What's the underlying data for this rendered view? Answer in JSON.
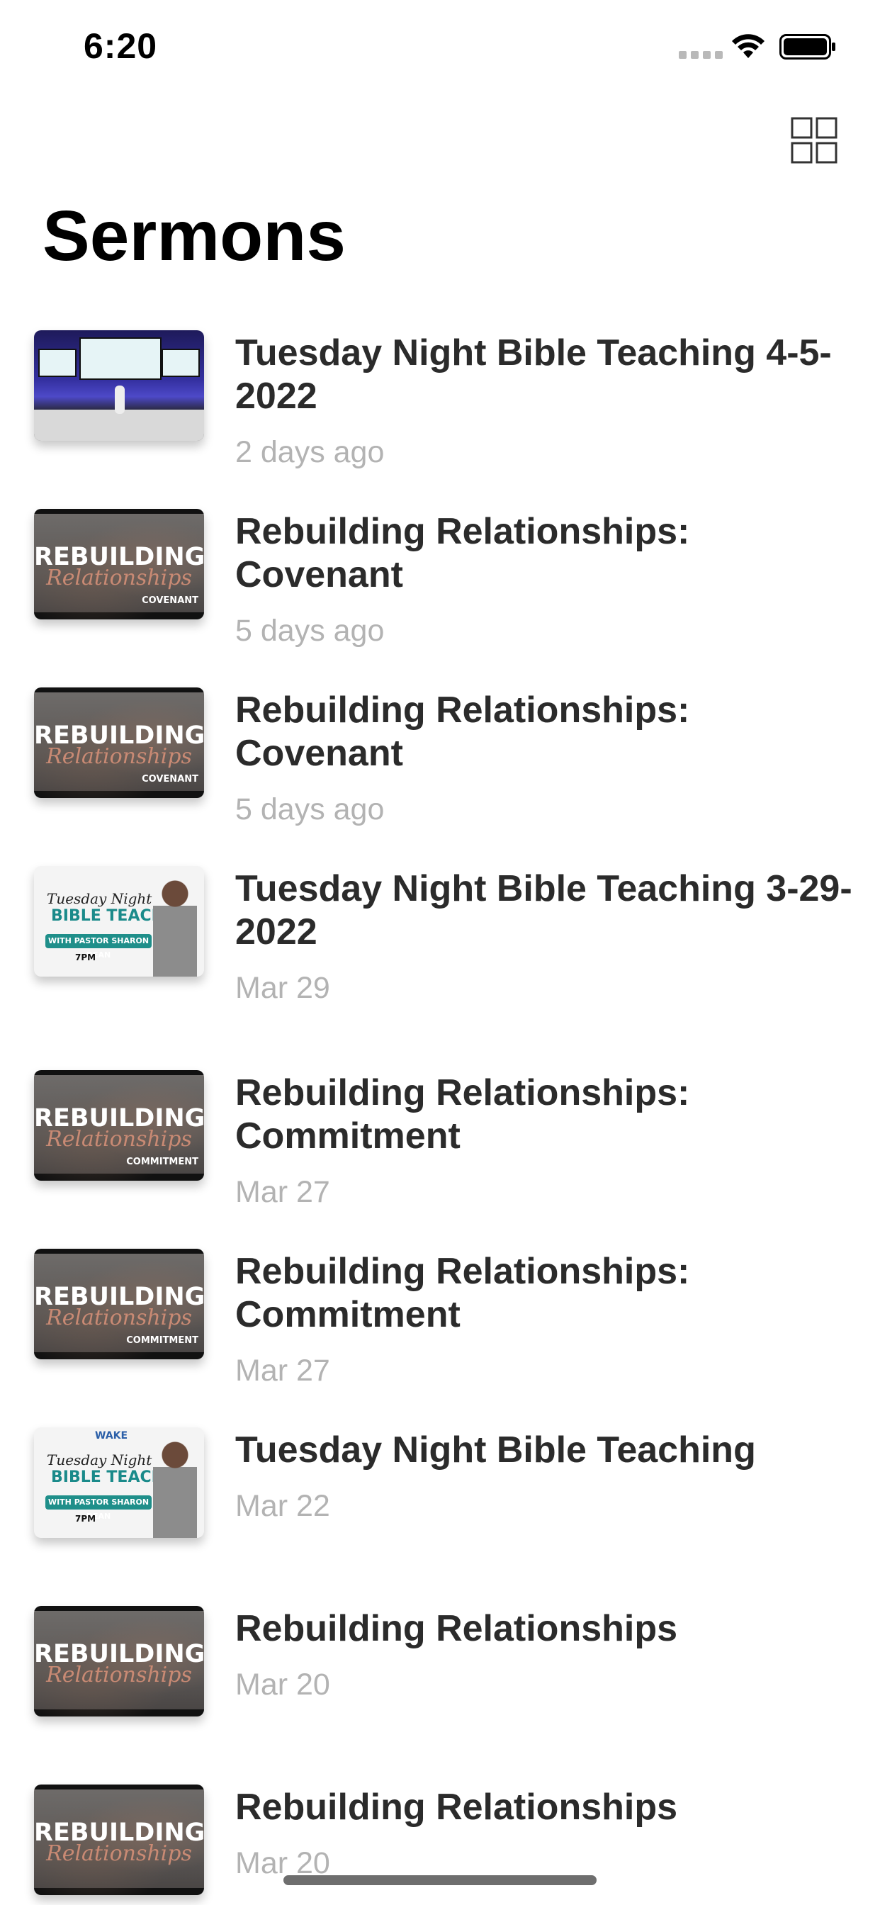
{
  "status_bar": {
    "time": "6:20"
  },
  "header": {
    "title": "Sermons",
    "grid_toggle_icon": "grid-icon"
  },
  "sermons": [
    {
      "title": "Tuesday Night Bible Teaching 4-5-2022",
      "date": "2 days ago",
      "thumbnail": "stage"
    },
    {
      "title": "Rebuilding Relationships: Covenant",
      "date": "5 days ago",
      "thumbnail": "rebuilding",
      "thumb_word": "REBUILDING",
      "thumb_script": "Relationships",
      "thumb_sub": "COVENANT"
    },
    {
      "title": "Rebuilding Relationships: Covenant",
      "date": "5 days ago",
      "thumbnail": "rebuilding",
      "thumb_word": "REBUILDING",
      "thumb_script": "Relationships",
      "thumb_sub": "COVENANT"
    },
    {
      "title": "Tuesday Night Bible Teaching 3-29-2022",
      "date": "Mar 29",
      "thumbnail": "tnbt",
      "thumb_script": "Tuesday Night",
      "thumb_bold": "BIBLE TEACHING",
      "thumb_band": "WITH PASTOR SHARON DEAN",
      "thumb_social": "7PM"
    },
    {
      "title": "Rebuilding Relationships: Commitment",
      "date": "Mar 27",
      "thumbnail": "rebuilding",
      "thumb_word": "REBUILDING",
      "thumb_script": "Relationships",
      "thumb_sub": "COMMITMENT"
    },
    {
      "title": "Rebuilding Relationships: Commitment",
      "date": "Mar 27",
      "thumbnail": "rebuilding",
      "thumb_word": "REBUILDING",
      "thumb_script": "Relationships",
      "thumb_sub": "COMMITMENT"
    },
    {
      "title": "Tuesday Night Bible Teaching",
      "date": "Mar 22",
      "thumbnail": "tnbt",
      "thumb_logo": "WAKE",
      "thumb_script": "Tuesday Night",
      "thumb_bold": "BIBLE TEACHING",
      "thumb_band": "WITH PASTOR SHARON DEAN",
      "thumb_social": "7PM"
    },
    {
      "title": "Rebuilding Relationships",
      "date": "Mar 20",
      "thumbnail": "rebuilding",
      "thumb_word": "REBUILDING",
      "thumb_script": "Relationships",
      "thumb_sub": ""
    },
    {
      "title": "Rebuilding Relationships",
      "date": "Mar 20",
      "thumbnail": "rebuilding",
      "thumb_word": "REBUILDING",
      "thumb_script": "Relationships",
      "thumb_sub": ""
    }
  ],
  "colors": {
    "title_text": "#2b2b2b",
    "date_text": "#b3b3b3",
    "teal_accent": "#1f8f8a"
  }
}
